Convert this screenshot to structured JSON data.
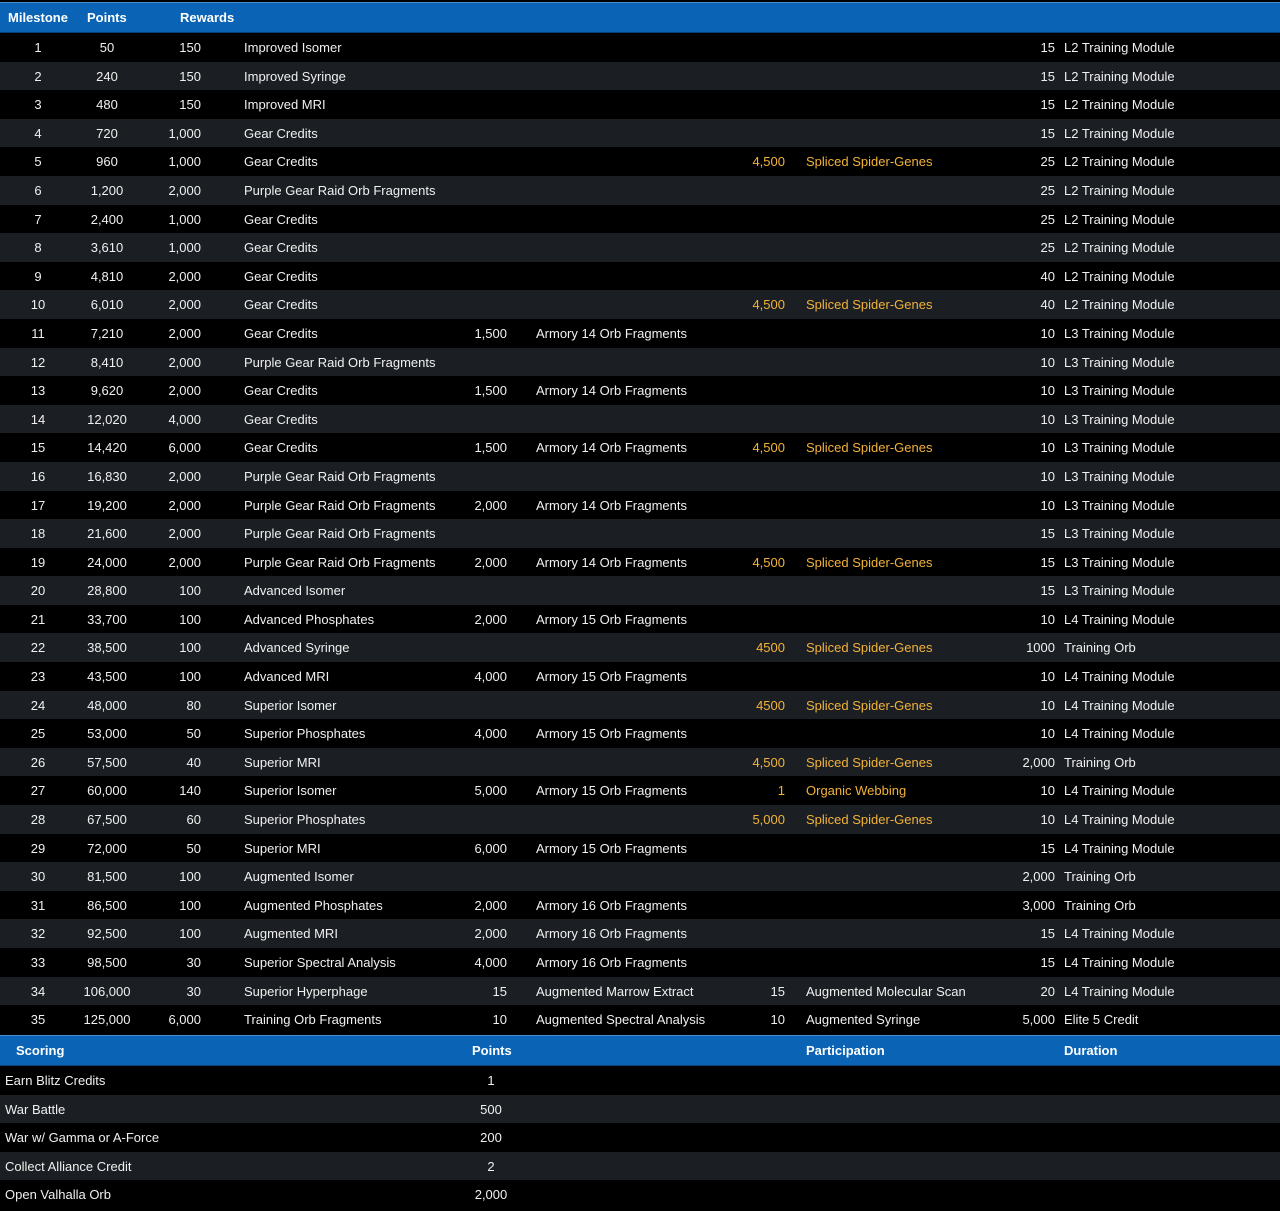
{
  "milestones": {
    "headers": {
      "milestone": "Milestone",
      "points": "Points",
      "rewards": "Rewards"
    },
    "rows": [
      {
        "m": "1",
        "p": "50",
        "r1n": "150",
        "r1": "Improved Isomer",
        "r2n": "",
        "r2": "",
        "r3n": "",
        "r3": "",
        "r4n": "15",
        "r4": "L2 Training Module"
      },
      {
        "m": "2",
        "p": "240",
        "r1n": "150",
        "r1": "Improved Syringe",
        "r2n": "",
        "r2": "",
        "r3n": "",
        "r3": "",
        "r4n": "15",
        "r4": "L2 Training Module"
      },
      {
        "m": "3",
        "p": "480",
        "r1n": "150",
        "r1": "Improved MRI",
        "r2n": "",
        "r2": "",
        "r3n": "",
        "r3": "",
        "r4n": "15",
        "r4": "L2 Training Module"
      },
      {
        "m": "4",
        "p": "720",
        "r1n": "1,000",
        "r1": "Gear Credits",
        "r2n": "",
        "r2": "",
        "r3n": "",
        "r3": "",
        "r4n": "15",
        "r4": "L2 Training Module"
      },
      {
        "m": "5",
        "p": "960",
        "r1n": "1,000",
        "r1": "Gear Credits",
        "r2n": "",
        "r2": "",
        "r3n": "4,500",
        "r3": "Spliced Spider-Genes",
        "r4n": "25",
        "r4": "L2 Training Module"
      },
      {
        "m": "6",
        "p": "1,200",
        "r1n": "2,000",
        "r1": "Purple Gear Raid Orb Fragments",
        "r2n": "",
        "r2": "",
        "r3n": "",
        "r3": "",
        "r4n": "25",
        "r4": "L2 Training Module"
      },
      {
        "m": "7",
        "p": "2,400",
        "r1n": "1,000",
        "r1": "Gear Credits",
        "r2n": "",
        "r2": "",
        "r3n": "",
        "r3": "",
        "r4n": "25",
        "r4": "L2 Training Module"
      },
      {
        "m": "8",
        "p": "3,610",
        "r1n": "1,000",
        "r1": "Gear Credits",
        "r2n": "",
        "r2": "",
        "r3n": "",
        "r3": "",
        "r4n": "25",
        "r4": "L2 Training Module"
      },
      {
        "m": "9",
        "p": "4,810",
        "r1n": "2,000",
        "r1": "Gear Credits",
        "r2n": "",
        "r2": "",
        "r3n": "",
        "r3": "",
        "r4n": "40",
        "r4": "L2 Training Module"
      },
      {
        "m": "10",
        "p": "6,010",
        "r1n": "2,000",
        "r1": "Gear Credits",
        "r2n": "",
        "r2": "",
        "r3n": "4,500",
        "r3": "Spliced Spider-Genes",
        "r4n": "40",
        "r4": "L2 Training Module"
      },
      {
        "m": "11",
        "p": "7,210",
        "r1n": "2,000",
        "r1": "Gear Credits",
        "r2n": "1,500",
        "r2": "Armory 14 Orb Fragments",
        "r3n": "",
        "r3": "",
        "r4n": "10",
        "r4": "L3 Training Module"
      },
      {
        "m": "12",
        "p": "8,410",
        "r1n": "2,000",
        "r1": "Purple Gear Raid Orb Fragments",
        "r2n": "",
        "r2": "",
        "r3n": "",
        "r3": "",
        "r4n": "10",
        "r4": "L3 Training Module"
      },
      {
        "m": "13",
        "p": "9,620",
        "r1n": "2,000",
        "r1": "Gear Credits",
        "r2n": "1,500",
        "r2": "Armory 14 Orb Fragments",
        "r3n": "",
        "r3": "",
        "r4n": "10",
        "r4": "L3 Training Module"
      },
      {
        "m": "14",
        "p": "12,020",
        "r1n": "4,000",
        "r1": "Gear Credits",
        "r2n": "",
        "r2": "",
        "r3n": "",
        "r3": "",
        "r4n": "10",
        "r4": "L3 Training Module"
      },
      {
        "m": "15",
        "p": "14,420",
        "r1n": "6,000",
        "r1": "Gear Credits",
        "r2n": "1,500",
        "r2": "Armory 14 Orb Fragments",
        "r3n": "4,500",
        "r3": "Spliced Spider-Genes",
        "r4n": "10",
        "r4": "L3 Training Module"
      },
      {
        "m": "16",
        "p": "16,830",
        "r1n": "2,000",
        "r1": "Purple Gear Raid Orb Fragments",
        "r2n": "",
        "r2": "",
        "r3n": "",
        "r3": "",
        "r4n": "10",
        "r4": "L3 Training Module"
      },
      {
        "m": "17",
        "p": "19,200",
        "r1n": "2,000",
        "r1": "Purple Gear Raid Orb Fragments",
        "r2n": "2,000",
        "r2": "Armory 14 Orb Fragments",
        "r3n": "",
        "r3": "",
        "r4n": "10",
        "r4": "L3 Training Module"
      },
      {
        "m": "18",
        "p": "21,600",
        "r1n": "2,000",
        "r1": "Purple Gear Raid Orb Fragments",
        "r2n": "",
        "r2": "",
        "r3n": "",
        "r3": "",
        "r4n": "15",
        "r4": "L3 Training Module"
      },
      {
        "m": "19",
        "p": "24,000",
        "r1n": "2,000",
        "r1": "Purple Gear Raid Orb Fragments",
        "r2n": "2,000",
        "r2": "Armory 14 Orb Fragments",
        "r3n": "4,500",
        "r3": "Spliced Spider-Genes",
        "r4n": "15",
        "r4": "L3 Training Module"
      },
      {
        "m": "20",
        "p": "28,800",
        "r1n": "100",
        "r1": "Advanced Isomer",
        "r2n": "",
        "r2": "",
        "r3n": "",
        "r3": "",
        "r4n": "15",
        "r4": "L3 Training Module"
      },
      {
        "m": "21",
        "p": "33,700",
        "r1n": "100",
        "r1": "Advanced Phosphates",
        "r2n": "2,000",
        "r2": "Armory 15 Orb Fragments",
        "r3n": "",
        "r3": "",
        "r4n": "10",
        "r4": "L4 Training Module"
      },
      {
        "m": "22",
        "p": "38,500",
        "r1n": "100",
        "r1": "Advanced Syringe",
        "r2n": "",
        "r2": "",
        "r3n": "4500",
        "r3": "Spliced Spider-Genes",
        "r4n": "1000",
        "r4": "Training Orb"
      },
      {
        "m": "23",
        "p": "43,500",
        "r1n": "100",
        "r1": "Advanced MRI",
        "r2n": "4,000",
        "r2": "Armory 15 Orb Fragments",
        "r3n": "",
        "r3": "",
        "r4n": "10",
        "r4": "L4 Training Module"
      },
      {
        "m": "24",
        "p": "48,000",
        "r1n": "80",
        "r1": "Superior Isomer",
        "r2n": "",
        "r2": "",
        "r3n": "4500",
        "r3": "Spliced Spider-Genes",
        "r4n": "10",
        "r4": "L4 Training Module"
      },
      {
        "m": "25",
        "p": "53,000",
        "r1n": "50",
        "r1": "Superior Phosphates",
        "r2n": "4,000",
        "r2": "Armory 15 Orb Fragments",
        "r3n": "",
        "r3": "",
        "r4n": "10",
        "r4": "L4 Training Module"
      },
      {
        "m": "26",
        "p": "57,500",
        "r1n": "40",
        "r1": "Superior MRI",
        "r2n": "",
        "r2": "",
        "r3n": "4,500",
        "r3": "Spliced Spider-Genes",
        "r4n": "2,000",
        "r4": "Training Orb"
      },
      {
        "m": "27",
        "p": "60,000",
        "r1n": "140",
        "r1": "Superior Isomer",
        "r2n": "5,000",
        "r2": "Armory 15 Orb Fragments",
        "r3n": "1",
        "r3": "Organic Webbing",
        "r4n": "10",
        "r4": "L4 Training Module"
      },
      {
        "m": "28",
        "p": "67,500",
        "r1n": "60",
        "r1": "Superior Phosphates",
        "r2n": "",
        "r2": "",
        "r3n": "5,000",
        "r3": "Spliced Spider-Genes",
        "r4n": "10",
        "r4": "L4 Training Module"
      },
      {
        "m": "29",
        "p": "72,000",
        "r1n": "50",
        "r1": "Superior MRI",
        "r2n": "6,000",
        "r2": "Armory 15 Orb Fragments",
        "r3n": "",
        "r3": "",
        "r4n": "15",
        "r4": "L4 Training Module"
      },
      {
        "m": "30",
        "p": "81,500",
        "r1n": "100",
        "r1": "Augmented Isomer",
        "r2n": "",
        "r2": "",
        "r3n": "",
        "r3": "",
        "r4n": "2,000",
        "r4": "Training Orb"
      },
      {
        "m": "31",
        "p": "86,500",
        "r1n": "100",
        "r1": "Augmented Phosphates",
        "r2n": "2,000",
        "r2": "Armory 16 Orb Fragments",
        "r3n": "",
        "r3": "",
        "r4n": "3,000",
        "r4": "Training Orb"
      },
      {
        "m": "32",
        "p": "92,500",
        "r1n": "100",
        "r1": "Augmented MRI",
        "r2n": "2,000",
        "r2": "Armory 16 Orb Fragments",
        "r3n": "",
        "r3": "",
        "r4n": "15",
        "r4": "L4 Training Module"
      },
      {
        "m": "33",
        "p": "98,500",
        "r1n": "30",
        "r1": "Superior Spectral Analysis",
        "r2n": "4,000",
        "r2": "Armory 16 Orb Fragments",
        "r3n": "",
        "r3": "",
        "r4n": "15",
        "r4": "L4 Training Module"
      },
      {
        "m": "34",
        "p": "106,000",
        "r1n": "30",
        "r1": "Superior Hyperphage",
        "r2n": "15",
        "r2": "Augmented Marrow Extract",
        "r3n": "15",
        "r3": "Augmented Molecular Scan",
        "r4n": "20",
        "r4": "L4 Training Module"
      },
      {
        "m": "35",
        "p": "125,000",
        "r1n": "6,000",
        "r1": "Training Orb Fragments",
        "r2n": "10",
        "r2": "Augmented Spectral Analysis",
        "r3n": "10",
        "r3": "Augmented Syringe",
        "r4n": "5,000",
        "r4": "Elite 5 Credit"
      }
    ]
  },
  "scoring": {
    "headers": {
      "scoring": "Scoring",
      "points": "Points",
      "participation": "Participation",
      "duration": "Duration"
    },
    "rows": [
      {
        "label": "Earn Blitz Credits",
        "points": "1"
      },
      {
        "label": "War Battle",
        "points": "500"
      },
      {
        "label": "War w/ Gamma or A-Force",
        "points": "200"
      },
      {
        "label": "Collect Alliance Credit",
        "points": "2"
      },
      {
        "label": "Open Valhalla Orb",
        "points": "2,000"
      }
    ]
  },
  "colors": {
    "header_bg": "#0a63b5",
    "row_dark": "#000000",
    "row_alt": "#1b1f23",
    "highlight": "#f2b23a"
  }
}
